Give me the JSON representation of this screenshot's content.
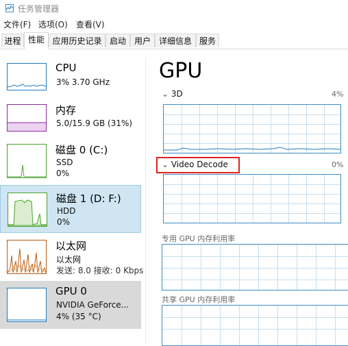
{
  "window": {
    "title": "任务管理器",
    "icon": "task-manager-icon"
  },
  "menu": [
    "文件(F)",
    "选项(O)",
    "查看(V)"
  ],
  "tabs": [
    "进程",
    "性能",
    "应用历史记录",
    "启动",
    "用户",
    "详细信息",
    "服务"
  ],
  "active_tab": "性能",
  "sidebar": [
    {
      "name": "CPU",
      "line1": "3% 3.70 GHz",
      "line2": "",
      "color": "#1e7ac0"
    },
    {
      "name": "内存",
      "line1": "5.0/15.9 GB (31%)",
      "line2": "",
      "color": "#8b2a9b"
    },
    {
      "name": "磁盘 0 (C:)",
      "line1": "SSD",
      "line2": "0%",
      "color": "#4aa02c"
    },
    {
      "name": "磁盘 1 (D: F:)",
      "line1": "HDD",
      "line2": "0%",
      "color": "#4aa02c"
    },
    {
      "name": "以太网",
      "line1": "以太网",
      "line2": "发送: 8.0  接收: 0 Kbps",
      "color": "#b85c12"
    },
    {
      "name": "GPU 0",
      "line1": "NVIDIA GeForce...",
      "line2": "4% (35 °C)",
      "color": "#1e7ac0"
    }
  ],
  "main": {
    "title": "GPU",
    "engines": [
      {
        "label": "3D",
        "percent": "4%"
      },
      {
        "label": "Video Decode",
        "percent": "0%"
      }
    ],
    "dedicated_memory_label": "专用 GPU 内存利用率",
    "shared_memory_label": "共享 GPU 内存利用率"
  },
  "colors": {
    "graph_border": "#3b8cc6",
    "grid": "#c8ddec",
    "highlight": "#e02020",
    "selected_bg": "#cfe6f2"
  }
}
